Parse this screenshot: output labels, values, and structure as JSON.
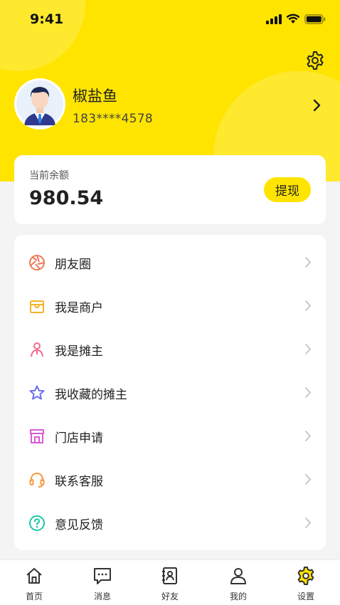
{
  "status_bar": {
    "time": "9:41"
  },
  "profile": {
    "nickname": "椒盐鱼",
    "phone": "183****4578"
  },
  "balance": {
    "label": "当前余额",
    "amount": "980.54",
    "withdraw_label": "提现"
  },
  "menu": [
    {
      "label": "朋友圈",
      "icon": "aperture-icon",
      "color": "#f07a5a"
    },
    {
      "label": "我是商户",
      "icon": "store-box-icon",
      "color": "#f5b324"
    },
    {
      "label": "我是摊主",
      "icon": "vendor-person-icon",
      "color": "#f06b8f"
    },
    {
      "label": "我收藏的摊主",
      "icon": "star-icon",
      "color": "#6a6ff0"
    },
    {
      "label": "门店申请",
      "icon": "shop-icon",
      "color": "#d65bd8"
    },
    {
      "label": "联系客服",
      "icon": "headset-icon",
      "color": "#f59a3c"
    },
    {
      "label": "意见反馈",
      "icon": "question-circle-icon",
      "color": "#1fc6a8"
    }
  ],
  "tabbar": [
    {
      "label": "首页",
      "icon": "home-icon"
    },
    {
      "label": "消息",
      "icon": "message-icon"
    },
    {
      "label": "好友",
      "icon": "contacts-icon"
    },
    {
      "label": "我的",
      "icon": "user-icon"
    },
    {
      "label": "设置",
      "icon": "gear-icon",
      "active": true
    }
  ],
  "colors": {
    "accent": "#ffe400",
    "background": "#f4f4f4"
  }
}
